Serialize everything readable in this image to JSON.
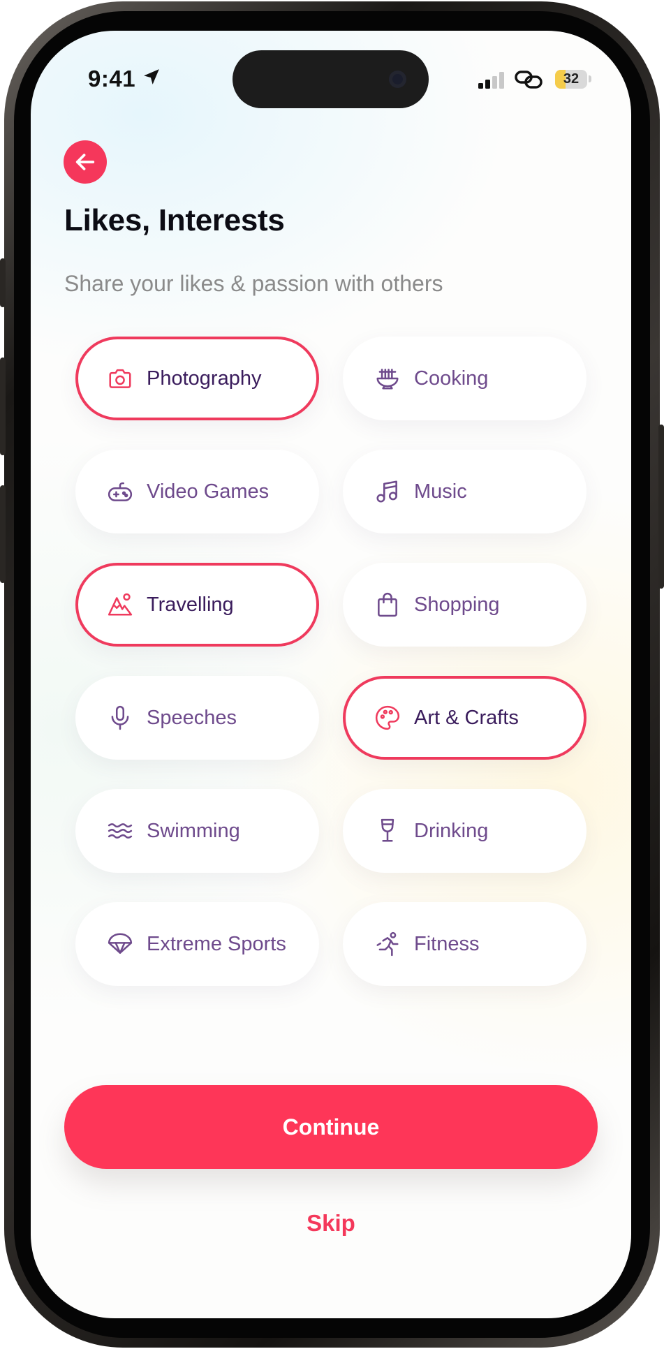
{
  "status_bar": {
    "time": "9:41",
    "battery": "32"
  },
  "header": {
    "title": "Likes, Interests",
    "subtitle": "Share your likes & passion with others"
  },
  "interests": [
    {
      "label": "Photography",
      "icon": "camera-icon",
      "selected": true
    },
    {
      "label": "Cooking",
      "icon": "noodle-bowl-icon",
      "selected": false
    },
    {
      "label": "Video Games",
      "icon": "gamepad-icon",
      "selected": false
    },
    {
      "label": "Music",
      "icon": "music-note-icon",
      "selected": false
    },
    {
      "label": "Travelling",
      "icon": "mountain-icon",
      "selected": true
    },
    {
      "label": "Shopping",
      "icon": "shopping-bag-icon",
      "selected": false
    },
    {
      "label": "Speeches",
      "icon": "microphone-icon",
      "selected": false
    },
    {
      "label": "Art & Crafts",
      "icon": "palette-icon",
      "selected": true
    },
    {
      "label": "Swimming",
      "icon": "waves-icon",
      "selected": false
    },
    {
      "label": "Drinking",
      "icon": "wine-glass-icon",
      "selected": false
    },
    {
      "label": "Extreme Sports",
      "icon": "parachute-icon",
      "selected": false
    },
    {
      "label": "Fitness",
      "icon": "running-icon",
      "selected": false
    }
  ],
  "actions": {
    "continue_label": "Continue",
    "skip_label": "Skip"
  },
  "colors": {
    "accent": "#FE3658",
    "chip_text": "#6E4A8C",
    "chip_text_selected": "#3A1C5C",
    "subtitle": "#8A8A8A"
  }
}
